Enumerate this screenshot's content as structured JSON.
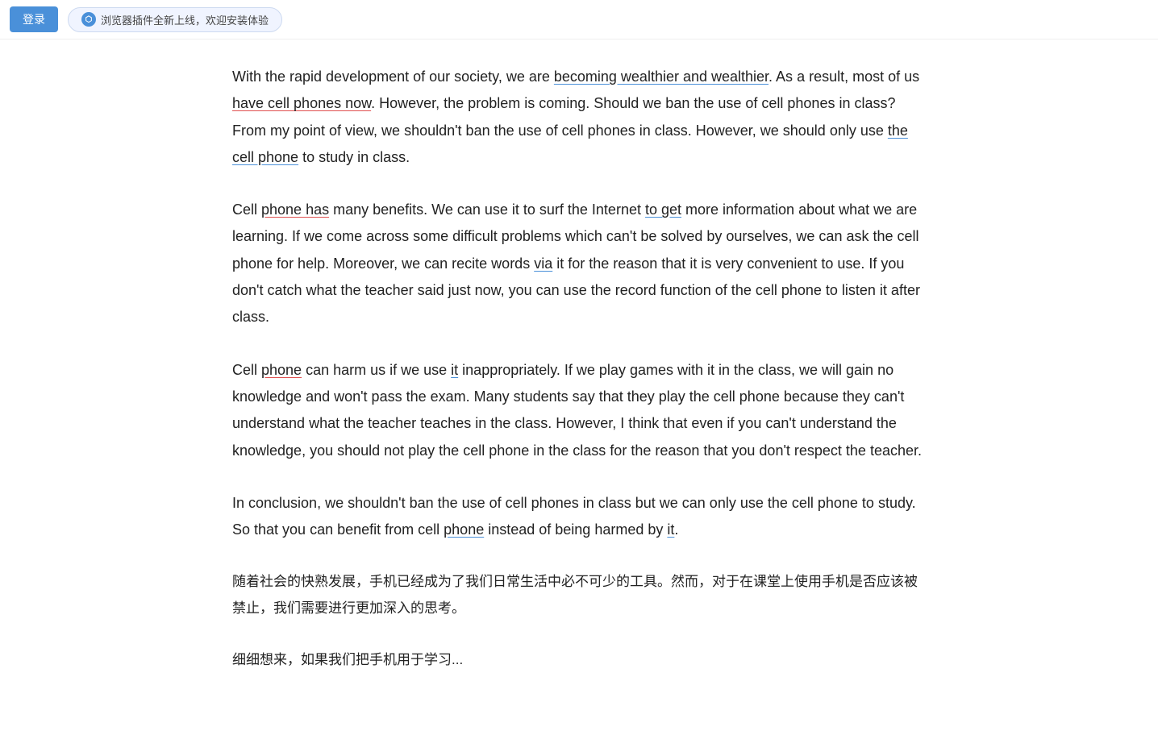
{
  "topbar": {
    "login_label": "登录",
    "plugin_banner_text": "浏览器插件全新上线，欢迎安装体验"
  },
  "paragraphs": [
    {
      "id": "para1",
      "text_parts": [
        {
          "text": "With the rapid development of our society, we are ",
          "type": "normal"
        },
        {
          "text": "becoming wealthier and wealthier",
          "type": "underline-blue"
        },
        {
          "text": ". As a result, most of us ",
          "type": "normal"
        },
        {
          "text": "have cell phones now",
          "type": "underline-red"
        },
        {
          "text": ". However, the problem is coming. Should we ban the use of cell phones in class? From my point of view, we shouldn’t ban the use of cell phones in class. However, we should only use ",
          "type": "normal"
        },
        {
          "text": "the cell phone",
          "type": "underline-blue"
        },
        {
          "text": " to study in class.",
          "type": "normal"
        }
      ]
    },
    {
      "id": "para2",
      "text_parts": [
        {
          "text": "Cell ",
          "type": "normal"
        },
        {
          "text": "phone has",
          "type": "underline-red"
        },
        {
          "text": " many benefits. We can use it to surf the Internet ",
          "type": "normal"
        },
        {
          "text": "to get",
          "type": "underline-blue"
        },
        {
          "text": " more information about what we are learning. If we come across some difficult problems which can’t be solved by ourselves, we can ask the cell phone for help. Moreover, we can recite words ",
          "type": "normal"
        },
        {
          "text": "via",
          "type": "underline-blue"
        },
        {
          "text": " it for the reason that it is very convenient to use. If you don’t catch what the teacher said just now, you can use the record function of the cell phone to listen it after class.",
          "type": "normal"
        }
      ]
    },
    {
      "id": "para3",
      "text_parts": [
        {
          "text": "Cell ",
          "type": "normal"
        },
        {
          "text": "phone",
          "type": "underline-red"
        },
        {
          "text": " can harm us if we use ",
          "type": "normal"
        },
        {
          "text": "it",
          "type": "underline-blue"
        },
        {
          "text": " inappropriately. If we play games with it in the class, we will gain no knowledge and won’t pass the exam. Many students say that they play the cell phone because they can’t understand what the teacher teaches in the class. However, I think that even if you can’t understand the knowledge, you should not play the cell phone in the class for the reason that you don’t respect the teacher.",
          "type": "normal"
        }
      ]
    },
    {
      "id": "para4",
      "text_parts": [
        {
          "text": "In conclusion, we shouldn’t ban the use of cell phones in class but we can only use the cell phone to study. So that you can benefit from cell ",
          "type": "normal"
        },
        {
          "text": "phone",
          "type": "underline-blue"
        },
        {
          "text": " instead of being harmed by ",
          "type": "normal"
        },
        {
          "text": "it",
          "type": "underline-blue"
        },
        {
          "text": ".",
          "type": "normal"
        }
      ]
    }
  ],
  "chinese_paragraph": "随着社会的快熟发展，手机已经成为了我们日常生活中必不可少的工具。然而，对于在课堂上使用手机是否应该被禁止，我们需要进行更加深入的思考。",
  "chinese_partial": "细细想来，如果我们把手机用于学习..."
}
